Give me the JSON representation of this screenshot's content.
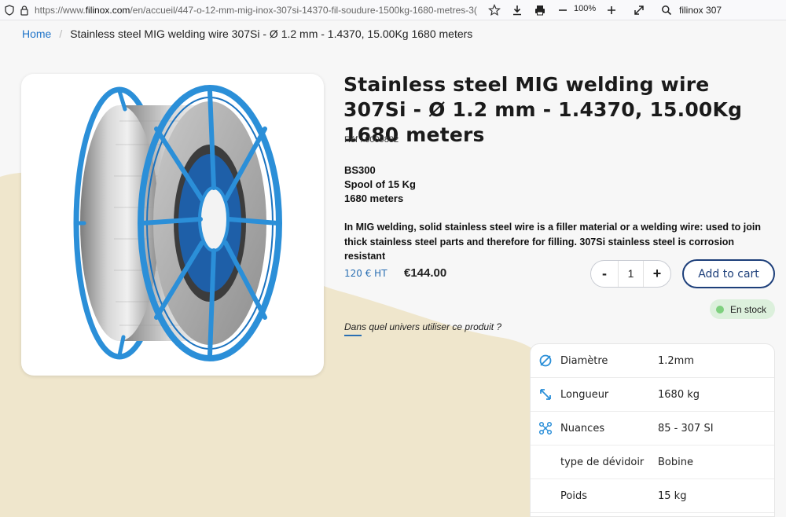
{
  "browser": {
    "url_prefix": "https://www.",
    "url_domain": "filinox.com",
    "url_path": "/en/accueil/447-o-12-mm-mig-inox-307si-14370-fil-soudure-1500kg-1680-metres-3(",
    "zoom": "100%",
    "search_text": "filinox 307",
    "icons": [
      "shield-icon",
      "lock-icon",
      "star-icon",
      "download-icon",
      "print-icon",
      "zoom-out-icon",
      "zoom-in-icon",
      "fullscreen-icon",
      "search-icon"
    ]
  },
  "breadcrumb": {
    "home": "Home",
    "separator": "/",
    "current": "Stainless steel MIG welding wire 307Si - Ø 1.2 mm - 1.4370, 15.00Kg 1680 meters"
  },
  "product": {
    "title": "Stainless steel MIG welding wire 307Si - Ø 1.2 mm - 1.4370, 15.00Kg 1680 meters",
    "reference": "Réf : 0009832",
    "specs": [
      "BS300",
      "Spool of 15 Kg",
      "1680 meters"
    ],
    "description": "In MIG welding, solid stainless steel wire is a filler material or a welding wire: used to join thick stainless steel parts and therefore for filling. 307Si stainless steel is corrosion resistant",
    "price_ht": "120 € HT",
    "price": "€144.00",
    "quantity": "1",
    "qty_minus": "-",
    "qty_plus": "+",
    "add_to_cart": "Add to cart",
    "stock_status": "En stock",
    "univers_link": "Dans quel univers utiliser ce produit ?",
    "colors": {
      "accent": "#1f74c9",
      "cart_border": "#1d3f7a",
      "stock_bg": "#dcf0dc",
      "blob": "#efe6cc",
      "spool_blue": "#2b8fd8"
    }
  },
  "attributes": [
    {
      "icon": "diameter-icon",
      "label": "Diamètre",
      "value": "1.2mm"
    },
    {
      "icon": "length-icon",
      "label": "Longueur",
      "value": "1680 kg"
    },
    {
      "icon": "nuances-icon",
      "label": "Nuances",
      "value": "85 - 307 SI"
    },
    {
      "icon": "",
      "label": "type de dévidoir",
      "value": "Bobine"
    },
    {
      "icon": "",
      "label": "Poids",
      "value": "15 kg"
    }
  ]
}
